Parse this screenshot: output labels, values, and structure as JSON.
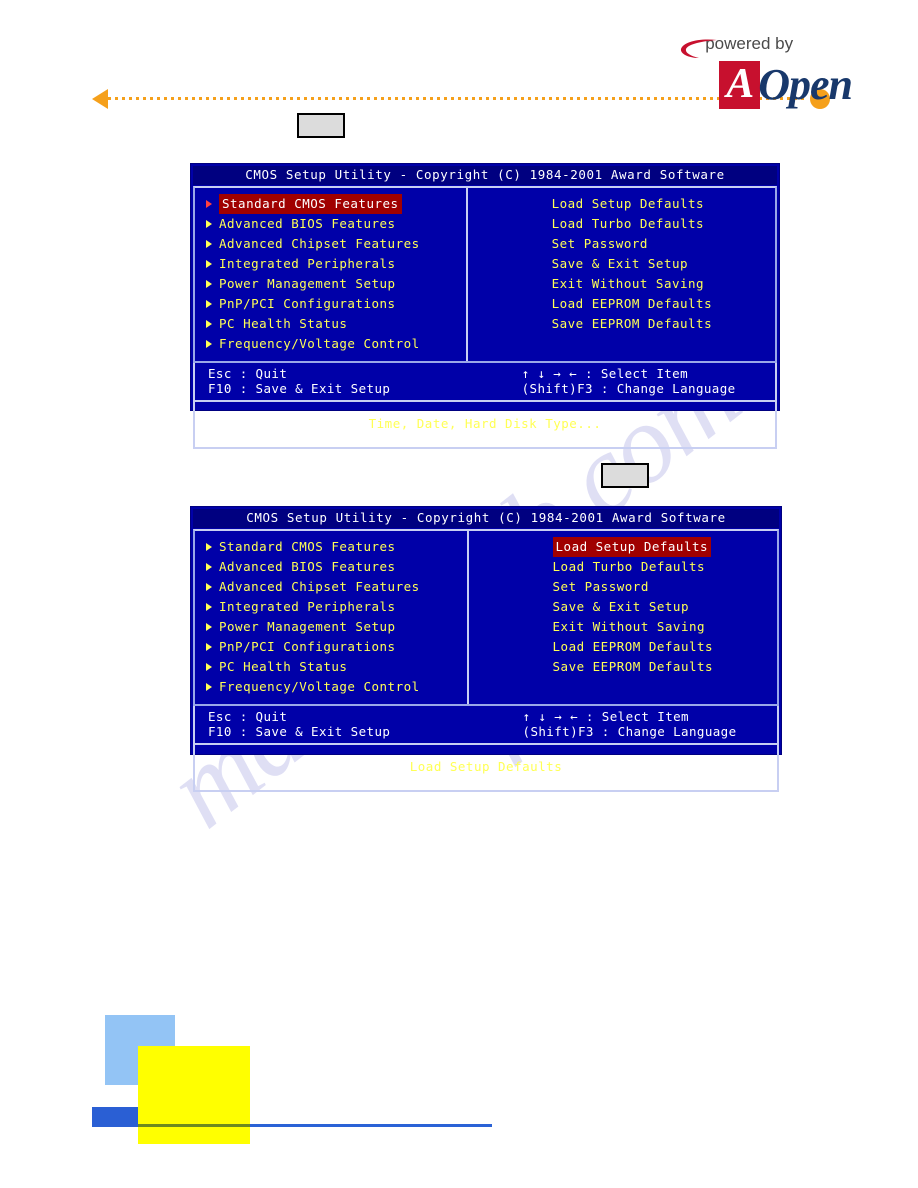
{
  "header": {
    "powered_by": "powered by",
    "brand_a": "A",
    "brand_open": "Open"
  },
  "bios_screens": [
    {
      "title": "CMOS Setup Utility - Copyright (C) 1984-2001 Award Software",
      "left_items": [
        "Standard CMOS Features",
        "Advanced BIOS Features",
        "Advanced Chipset Features",
        "Integrated Peripherals",
        "Power Management Setup",
        "PnP/PCI Configurations",
        "PC Health Status",
        "Frequency/Voltage Control"
      ],
      "right_items": [
        "Load Setup Defaults",
        "Load Turbo Defaults",
        "Set Password",
        "Save & Exit Setup",
        "Exit Without Saving",
        "Load EEPROM Defaults",
        "Save EEPROM Defaults"
      ],
      "selected_column": "left",
      "selected_index": 0,
      "help_left": [
        "Esc : Quit",
        "F10 : Save & Exit Setup"
      ],
      "help_right": [
        "↑ ↓ → ←   : Select Item",
        "(Shift)F3 : Change Language"
      ],
      "status": "Time, Date, Hard Disk Type..."
    },
    {
      "title": "CMOS Setup Utility - Copyright (C) 1984-2001 Award Software",
      "left_items": [
        "Standard CMOS Features",
        "Advanced BIOS Features",
        "Advanced Chipset Features",
        "Integrated Peripherals",
        "Power Management Setup",
        "PnP/PCI Configurations",
        "PC Health Status",
        "Frequency/Voltage Control"
      ],
      "right_items": [
        "Load Setup Defaults",
        "Load Turbo Defaults",
        "Set Password",
        "Save & Exit Setup",
        "Exit Without Saving",
        "Load EEPROM Defaults",
        "Save EEPROM Defaults"
      ],
      "selected_column": "right",
      "selected_index": 0,
      "help_left": [
        "Esc : Quit",
        "F10 : Save & Exit Setup"
      ],
      "help_right": [
        "↑ ↓ → ←   : Select Item",
        "(Shift)F3 : Change Language"
      ],
      "status": "Load Setup Defaults"
    }
  ],
  "watermark": {
    "line_1": "manualslib.com",
    "line_2": "manualslib.com"
  },
  "colors": {
    "bios_background": "#0000a8",
    "bios_titlebar": "#000080",
    "bios_text": "#ffff55",
    "bios_highlight": "#a00000",
    "accent_orange": "#f5a01b",
    "brand_red": "#c7102e",
    "brand_blue": "#18386b"
  }
}
